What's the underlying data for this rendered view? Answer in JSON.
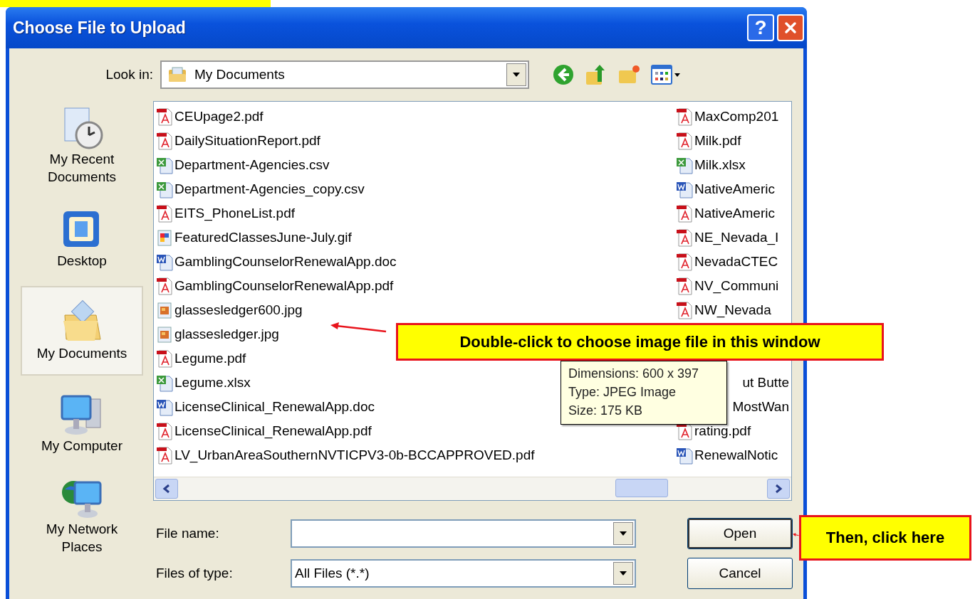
{
  "window": {
    "title": "Choose File to Upload",
    "help_label": "?"
  },
  "look_in": {
    "label": "Look in:",
    "value": "My Documents"
  },
  "places": [
    {
      "label": "My Recent Documents",
      "selected": false
    },
    {
      "label": "Desktop",
      "selected": false
    },
    {
      "label": "My Documents",
      "selected": true
    },
    {
      "label": "My Computer",
      "selected": false
    },
    {
      "label": "My Network Places",
      "selected": false
    }
  ],
  "files_left": [
    {
      "name": "CEUpage2.pdf",
      "kind": "pdf"
    },
    {
      "name": "DailySituationReport.pdf",
      "kind": "pdf"
    },
    {
      "name": "Department-Agencies.csv",
      "kind": "sheet"
    },
    {
      "name": "Department-Agencies_copy.csv",
      "kind": "sheet"
    },
    {
      "name": "EITS_PhoneList.pdf",
      "kind": "pdf"
    },
    {
      "name": "FeaturedClassesJune-July.gif",
      "kind": "gif"
    },
    {
      "name": "GamblingCounselorRenewalApp.doc",
      "kind": "word"
    },
    {
      "name": "GamblingCounselorRenewalApp.pdf",
      "kind": "pdf"
    },
    {
      "name": "glassesledger600.jpg",
      "kind": "jpeg"
    },
    {
      "name": "glassesledger.jpg",
      "kind": "jpeg"
    },
    {
      "name": "Legume.pdf",
      "kind": "pdf"
    },
    {
      "name": "Legume.xlsx",
      "kind": "sheet"
    },
    {
      "name": "LicenseClinical_RenewalApp.doc",
      "kind": "word"
    },
    {
      "name": "LicenseClinical_RenewalApp.pdf",
      "kind": "pdf"
    },
    {
      "name": "LV_UrbanAreaSouthernNVTICPV3-0b-BCCAPPROVED.pdf",
      "kind": "pdf"
    }
  ],
  "files_right": [
    {
      "name": "MaxComp201",
      "kind": "pdf"
    },
    {
      "name": "Milk.pdf",
      "kind": "pdf"
    },
    {
      "name": "Milk.xlsx",
      "kind": "sheet"
    },
    {
      "name": "NativeAmeric",
      "kind": "word"
    },
    {
      "name": "NativeAmeric",
      "kind": "pdf"
    },
    {
      "name": "NE_Nevada_I",
      "kind": "pdf"
    },
    {
      "name": "NevadaCTEC",
      "kind": "pdf"
    },
    {
      "name": "NV_Communi",
      "kind": "pdf"
    },
    {
      "name": "NW_Nevada",
      "kind": "pdf"
    },
    {
      "name": "ut Butte",
      "kind": "partial"
    },
    {
      "name": "MostWan",
      "kind": "partial"
    },
    {
      "name": "rating.pdf",
      "kind": "pdf"
    },
    {
      "name": "RenewalNotic",
      "kind": "word"
    }
  ],
  "tooltip": {
    "lines": [
      "Dimensions: 600 x 397",
      "Type: JPEG Image",
      "Size: 175 KB"
    ]
  },
  "file_name": {
    "label": "File name:"
  },
  "file_type": {
    "label": "Files of type:",
    "value": "All Files (*.*)"
  },
  "buttons": [
    {
      "label": "Open",
      "default": true
    },
    {
      "label": "Cancel",
      "default": false
    }
  ],
  "callouts": [
    {
      "text": "Double-click to choose image file in this window"
    },
    {
      "text": "Then, click here"
    }
  ]
}
